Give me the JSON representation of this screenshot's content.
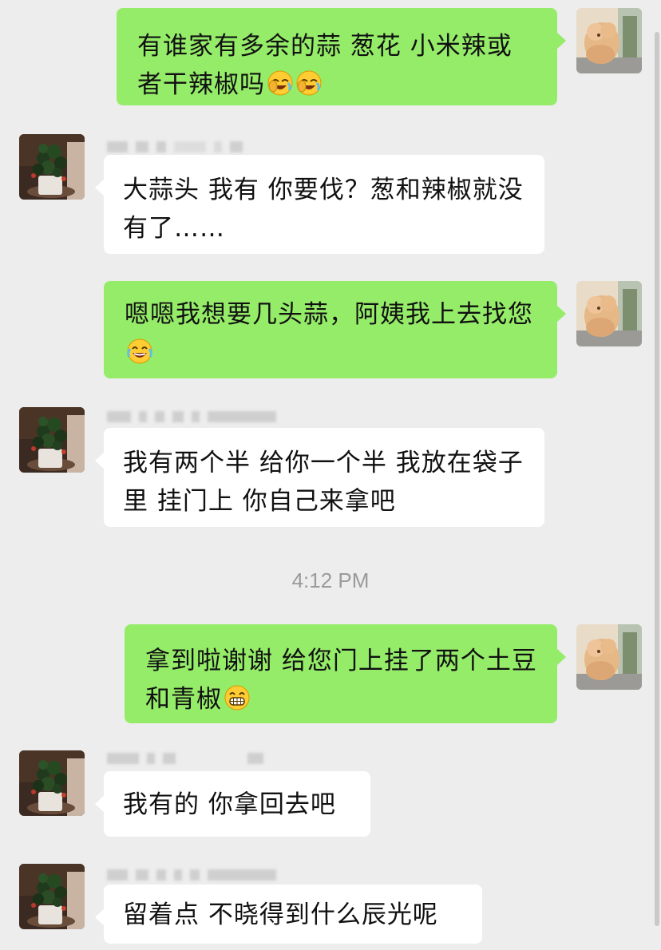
{
  "messages": [
    {
      "sender": "me",
      "text": "有谁家有多余的蒜 葱花 小米辣或者干辣椒吗",
      "emoji": [
        "facepalm-laugh-emoji",
        "facepalm-laugh-emoji"
      ]
    },
    {
      "sender": "other",
      "text": "大蒜头 我有 你要伐？葱和辣椒就没有了……"
    },
    {
      "sender": "me",
      "text": "嗯嗯我想要几头蒜，阿姨我上去找您",
      "emoji": [
        "tears-of-joy-emoji"
      ]
    },
    {
      "sender": "other",
      "text": "我有两个半 给你一个半 我放在袋子里 挂门上 你自己来拿吧"
    },
    {
      "sender": "me",
      "text": "拿到啦谢谢 给您门上挂了两个土豆和青椒",
      "emoji": [
        "grin-emoji"
      ]
    },
    {
      "sender": "other",
      "text": "我有的 你拿回去吧"
    },
    {
      "sender": "other",
      "text": "留着点 不晓得到什么辰光呢"
    }
  ],
  "timestamp": "4:12 PM",
  "colors": {
    "background": "#ededed",
    "my_bubble": "#95ec69",
    "their_bubble": "#ffffff",
    "timestamp_text": "#9a9a9a"
  },
  "avatars": {
    "me": "dog-photo-avatar",
    "other": "potted-plant-photo-avatar"
  }
}
